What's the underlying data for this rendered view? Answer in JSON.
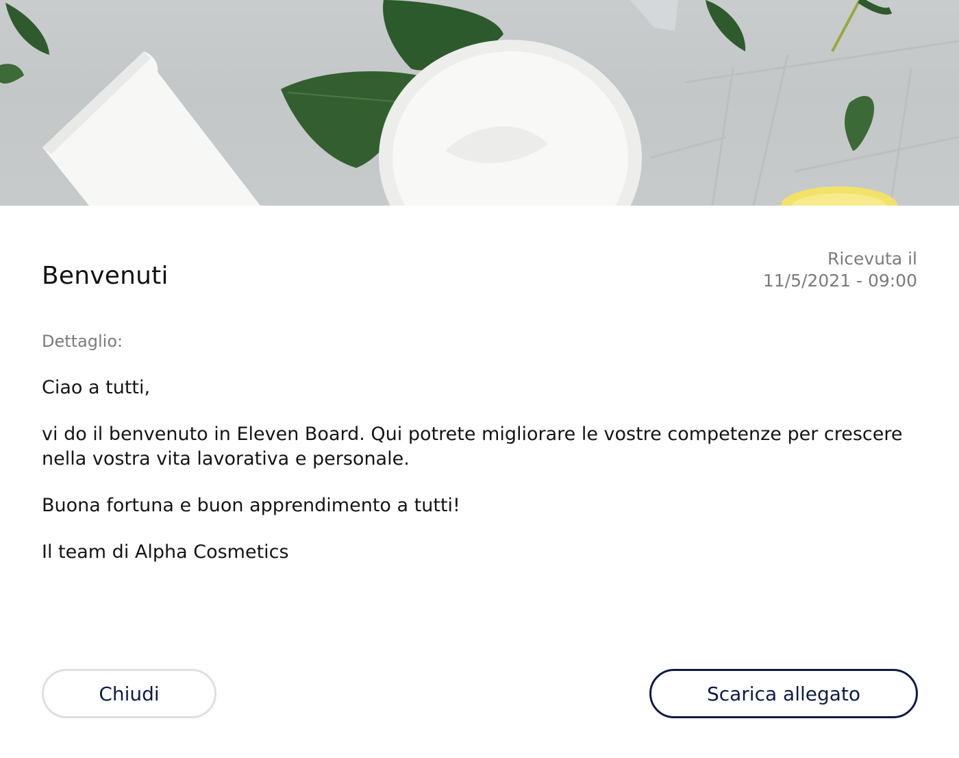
{
  "message": {
    "title": "Benvenuti",
    "received_label": "Ricevuta il",
    "received_datetime": "11/5/2021 - 09:00",
    "detail_label": "Dettaglio:",
    "paragraphs": [
      "Ciao a tutti,",
      "vi do il benvenuto in Eleven Board. Qui potrete migliorare le vostre competenze per crescere nella vostra vita lavorativa e personale.",
      "Buona fortuna e buon apprendimento a tutti!",
      "Il team di Alpha Cosmetics"
    ]
  },
  "actions": {
    "close_label": "Chiudi",
    "download_label": "Scarica allegato"
  },
  "colors": {
    "button_text": "#0e1b47",
    "primary_border": "#0d1a45",
    "secondary_border": "#dedee6",
    "muted_text": "#7b7b7b"
  }
}
